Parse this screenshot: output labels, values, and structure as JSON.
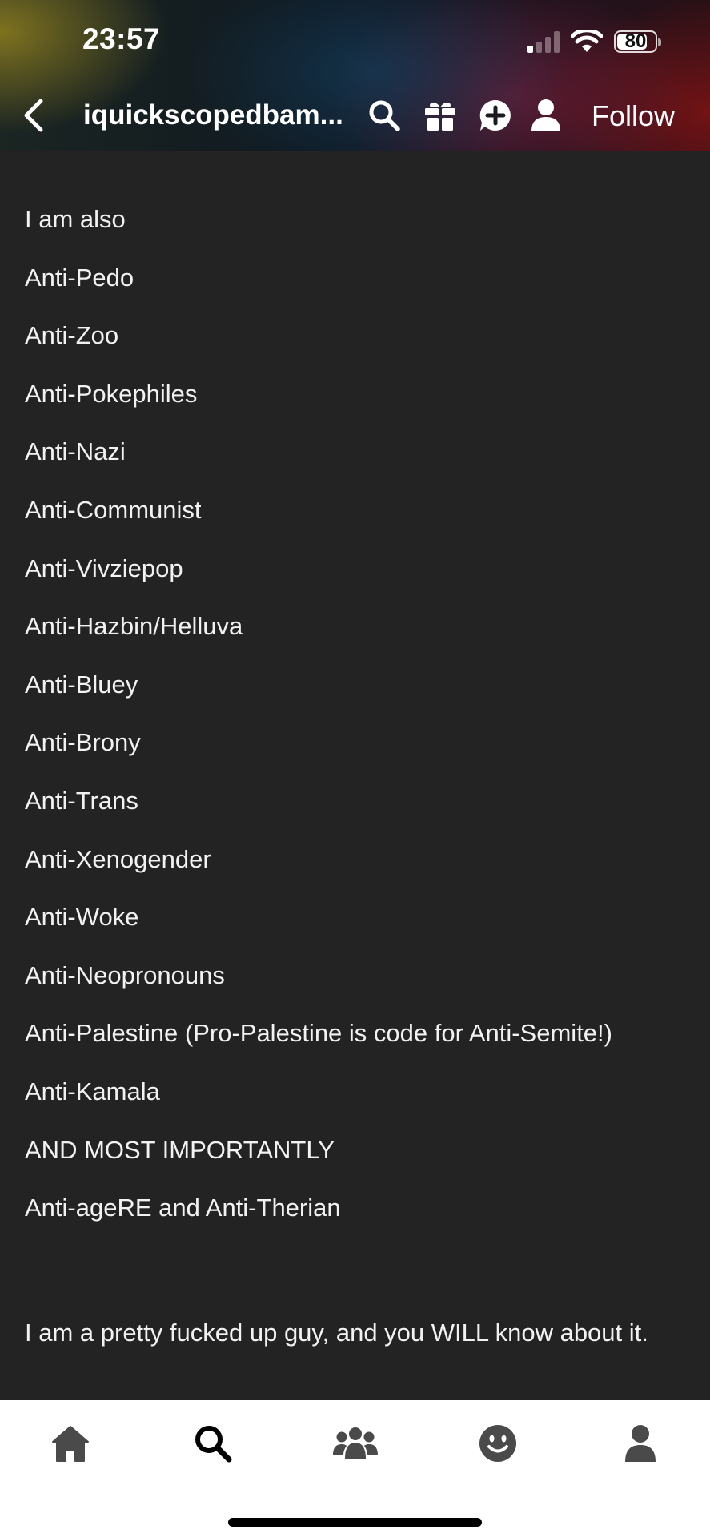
{
  "status_bar": {
    "time": "23:57",
    "battery_percent": "80",
    "battery_level": 0.8,
    "signal_bars_active": 1
  },
  "header": {
    "blog_name": "iquickscopedbam...",
    "follow_label": "Follow",
    "icons": [
      "back-chevron-icon",
      "search-icon",
      "gift-icon",
      "ask-plus-icon",
      "user-icon"
    ]
  },
  "post": {
    "lines": [
      "I am also",
      "Anti-Pedo",
      "Anti-Zoo",
      "Anti-Pokephiles",
      "Anti-Nazi",
      "Anti-Communist",
      "Anti-Vivziepop",
      "Anti-Hazbin/Helluva",
      "Anti-Bluey",
      "Anti-Brony",
      "Anti-Trans",
      "Anti-Xenogender",
      "Anti-Woke",
      "Anti-Neopronouns",
      "Anti-Palestine (Pro-Palestine is code for Anti-Semite!)",
      "Anti-Kamala",
      "AND MOST IMPORTANTLY",
      "Anti-ageRE and Anti-Therian"
    ],
    "closing": "I am a pretty fucked up guy, and you WILL know about it."
  },
  "tab_bar": {
    "tabs": [
      "home-icon",
      "search-icon",
      "communities-icon",
      "activity-face-icon",
      "account-icon"
    ]
  },
  "colors": {
    "background": "#232323",
    "text": "#f2f2f2",
    "tab_bar": "#ffffff",
    "tab_icon": "#4a4a4a",
    "tab_icon_active": "#000000"
  }
}
